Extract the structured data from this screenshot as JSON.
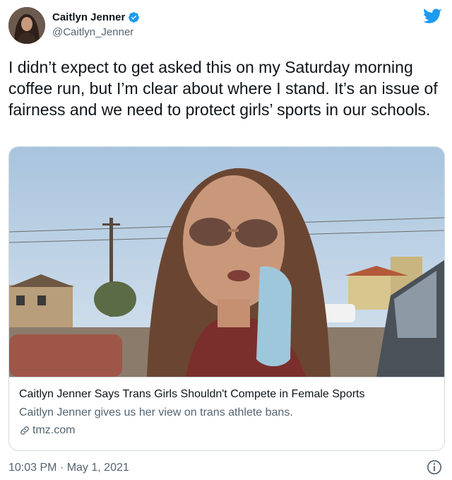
{
  "author": {
    "display_name": "Caitlyn Jenner",
    "handle": "@Caitlyn_Jenner",
    "verified": true
  },
  "icons": {
    "verified": "verified-badge-icon",
    "brand": "twitter-bird-icon",
    "link": "link-icon",
    "info": "info-icon"
  },
  "tweet": {
    "text": "I didn’t expect to get asked this on my Saturday morning coffee run, but I’m clear about where I stand. It’s an issue of fairness and we need to protect girls’ sports in our schools."
  },
  "card": {
    "title": "Caitlyn Jenner Says Trans Girls Shouldn't Compete in Female Sports",
    "description": "Caitlyn Jenner gives us her view on trans athlete bans.",
    "domain": "tmz.com"
  },
  "footer": {
    "timestamp": "10:03 PM · May 1, 2021"
  },
  "colors": {
    "brand_blue": "#1d9bf0",
    "text_primary": "#0f1419",
    "text_secondary": "#536471",
    "border": "#cfd9de"
  }
}
